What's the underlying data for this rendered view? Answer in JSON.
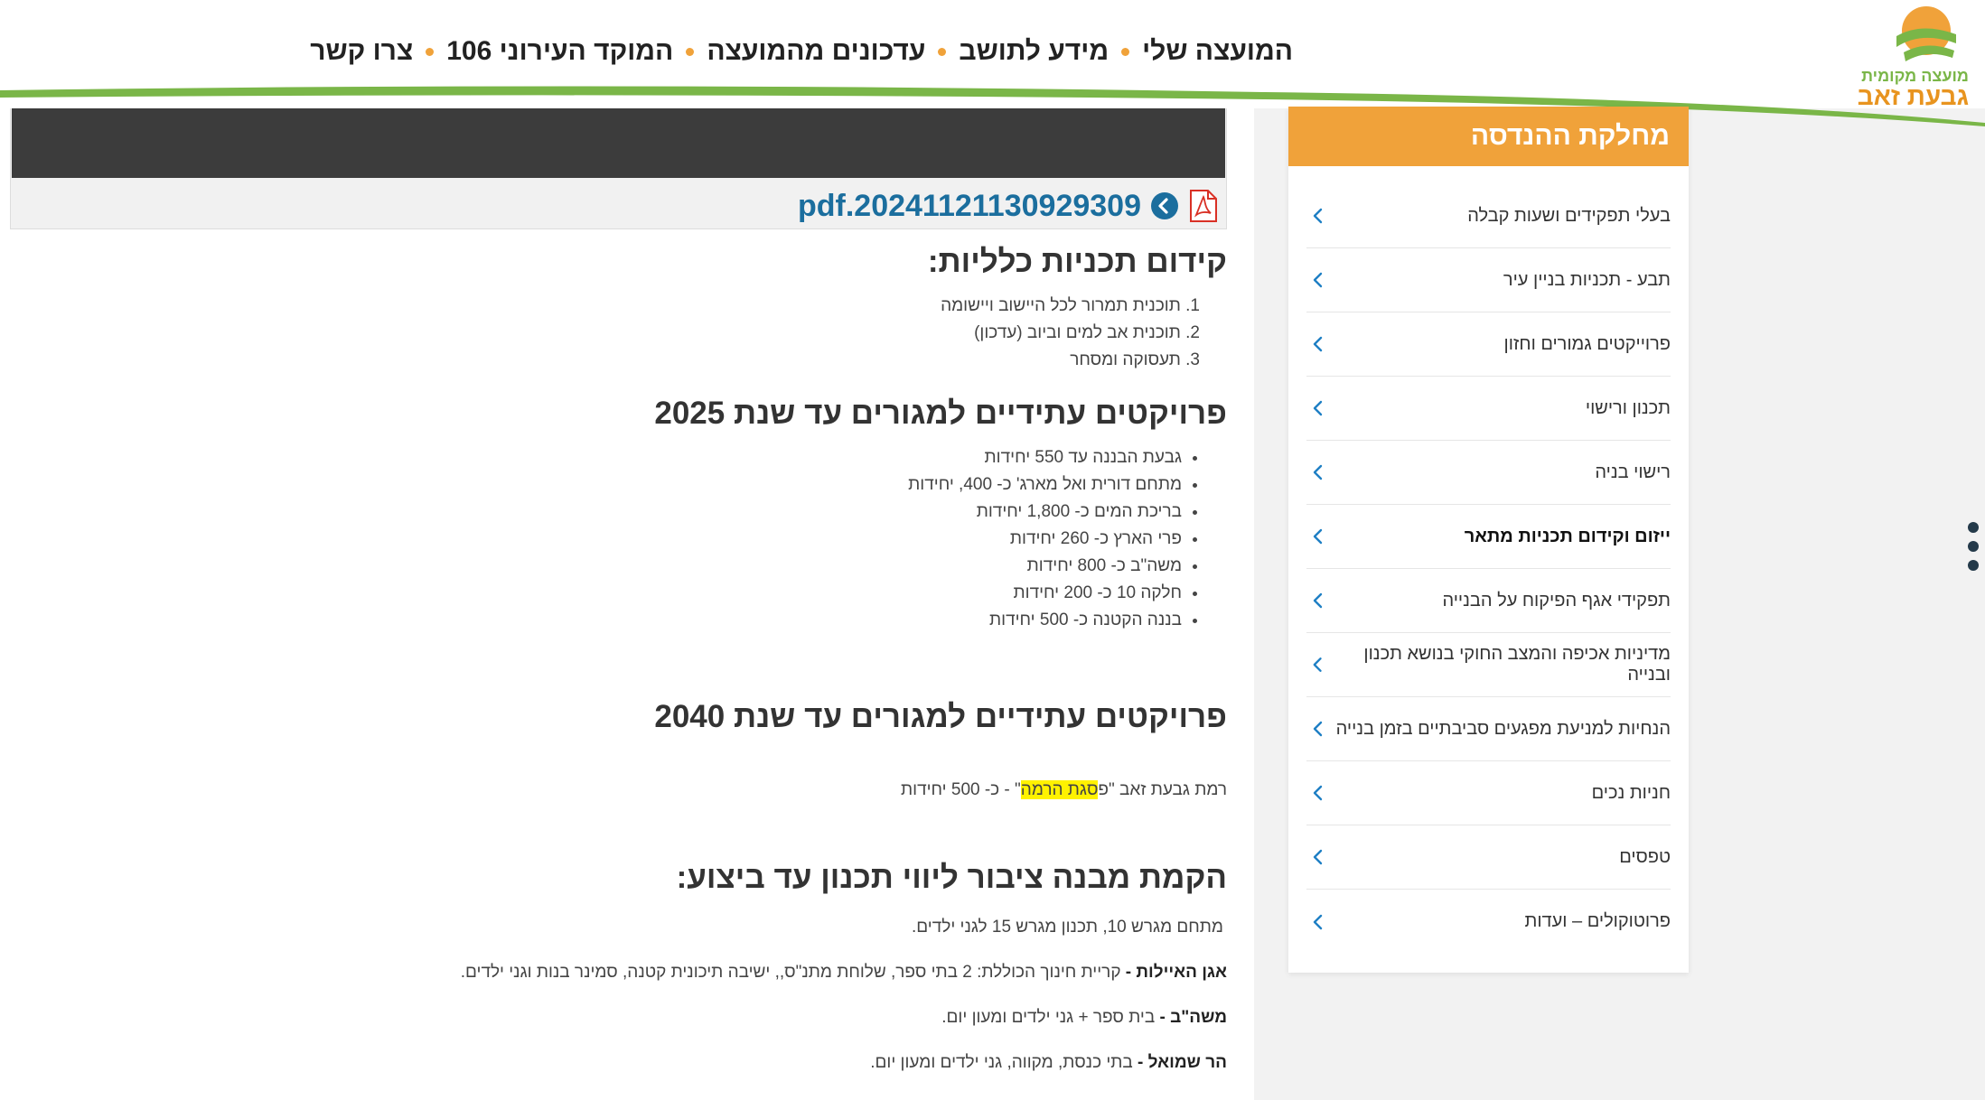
{
  "logo": {
    "small_text": "מועצה מקומית",
    "big_text": "גבעת זאב"
  },
  "nav": {
    "items": [
      "המועצה שלי",
      "מידע לתושב",
      "עדכונים מהמועצה",
      "המוקד העירוני 106",
      "צרו קשר"
    ]
  },
  "sidebar": {
    "title": "מחלקת ההנדסה",
    "items": [
      "בעלי תפקידים ושעות קבלה",
      "תבע - תכניות בניין עיר",
      "פרוייקטים גמורים וחזון",
      "תכנון ורישוי",
      "רישוי בניה",
      "ייזום וקידום תכניות מתאר",
      "תפקידי אגף הפיקוח על הבנייה",
      "מדיניות אכיפה והמצב החוקי בנושא תכנון ובנייה",
      "הנחיות למניעת מפגעים סביבתיים בזמן בנייה",
      "חניות נכים",
      "טפסים",
      "פרוטוקולים – ועדות"
    ],
    "active_index": 5
  },
  "file": {
    "name": "pdf.20241121130929309"
  },
  "sections": {
    "general_plans": {
      "title": "קידום תכניות כלליות:",
      "items": [
        "1. תוכנית תמרור לכל היישוב ויישומה",
        "2. תוכנית אב למים וביוב (עדכון)",
        "3. תעסוקה ומסחר"
      ]
    },
    "projects_2025": {
      "title": "פרויקטים עתידיים למגורים עד שנת 2025",
      "items": [
        "גבעת הבננה עד 550 יחידות",
        "מתחם דורית ואל מארג' כ- 400, יחידות",
        "בריכת המים כ- 1,800 יחידות",
        "פרי הארץ כ- 260 יחידות",
        "משה\"ב  כ- 800 יחידות",
        "חלקה 10 כ- 200 יחידות",
        "בננה הקטנה כ- 500 יחידות"
      ]
    },
    "projects_2040": {
      "title_main": "פרויקטים עתידיים למגורים עד שנת ",
      "title_year": "2040",
      "line_pre": "רמת גבעת זאב \"פ",
      "line_hl": "סגת הרמה",
      "line_post": "\" - כ- 500 יחידות"
    },
    "public_building": {
      "title": "הקמת מבנה ציבור ליווי תכנון עד ביצוע:",
      "lines": [
        {
          "bold": "",
          "text": "מתחם מגרש 10, תכנון מגרש 15 לגני ילדים."
        },
        {
          "bold": "אגן האיילות - ",
          "text": "קריית חינוך הכוללת: 2 בתי ספר, שלוחת מתנ\"ס,, ישיבה תיכונית קטנה, סמינר בנות וגני ילדים."
        },
        {
          "bold": "משה\"ב - ",
          "text": "בית ספר + גני ילדים ומעון יום."
        },
        {
          "bold": "הר שמואל - ",
          "text": "בתי כנסת, מקווה, גני ילדים ומעון יום."
        }
      ]
    }
  },
  "colors": {
    "accent_orange": "#f0a23a",
    "brand_green": "#7ab648",
    "link_blue": "#1b6e9e",
    "highlight": "#fff200"
  }
}
